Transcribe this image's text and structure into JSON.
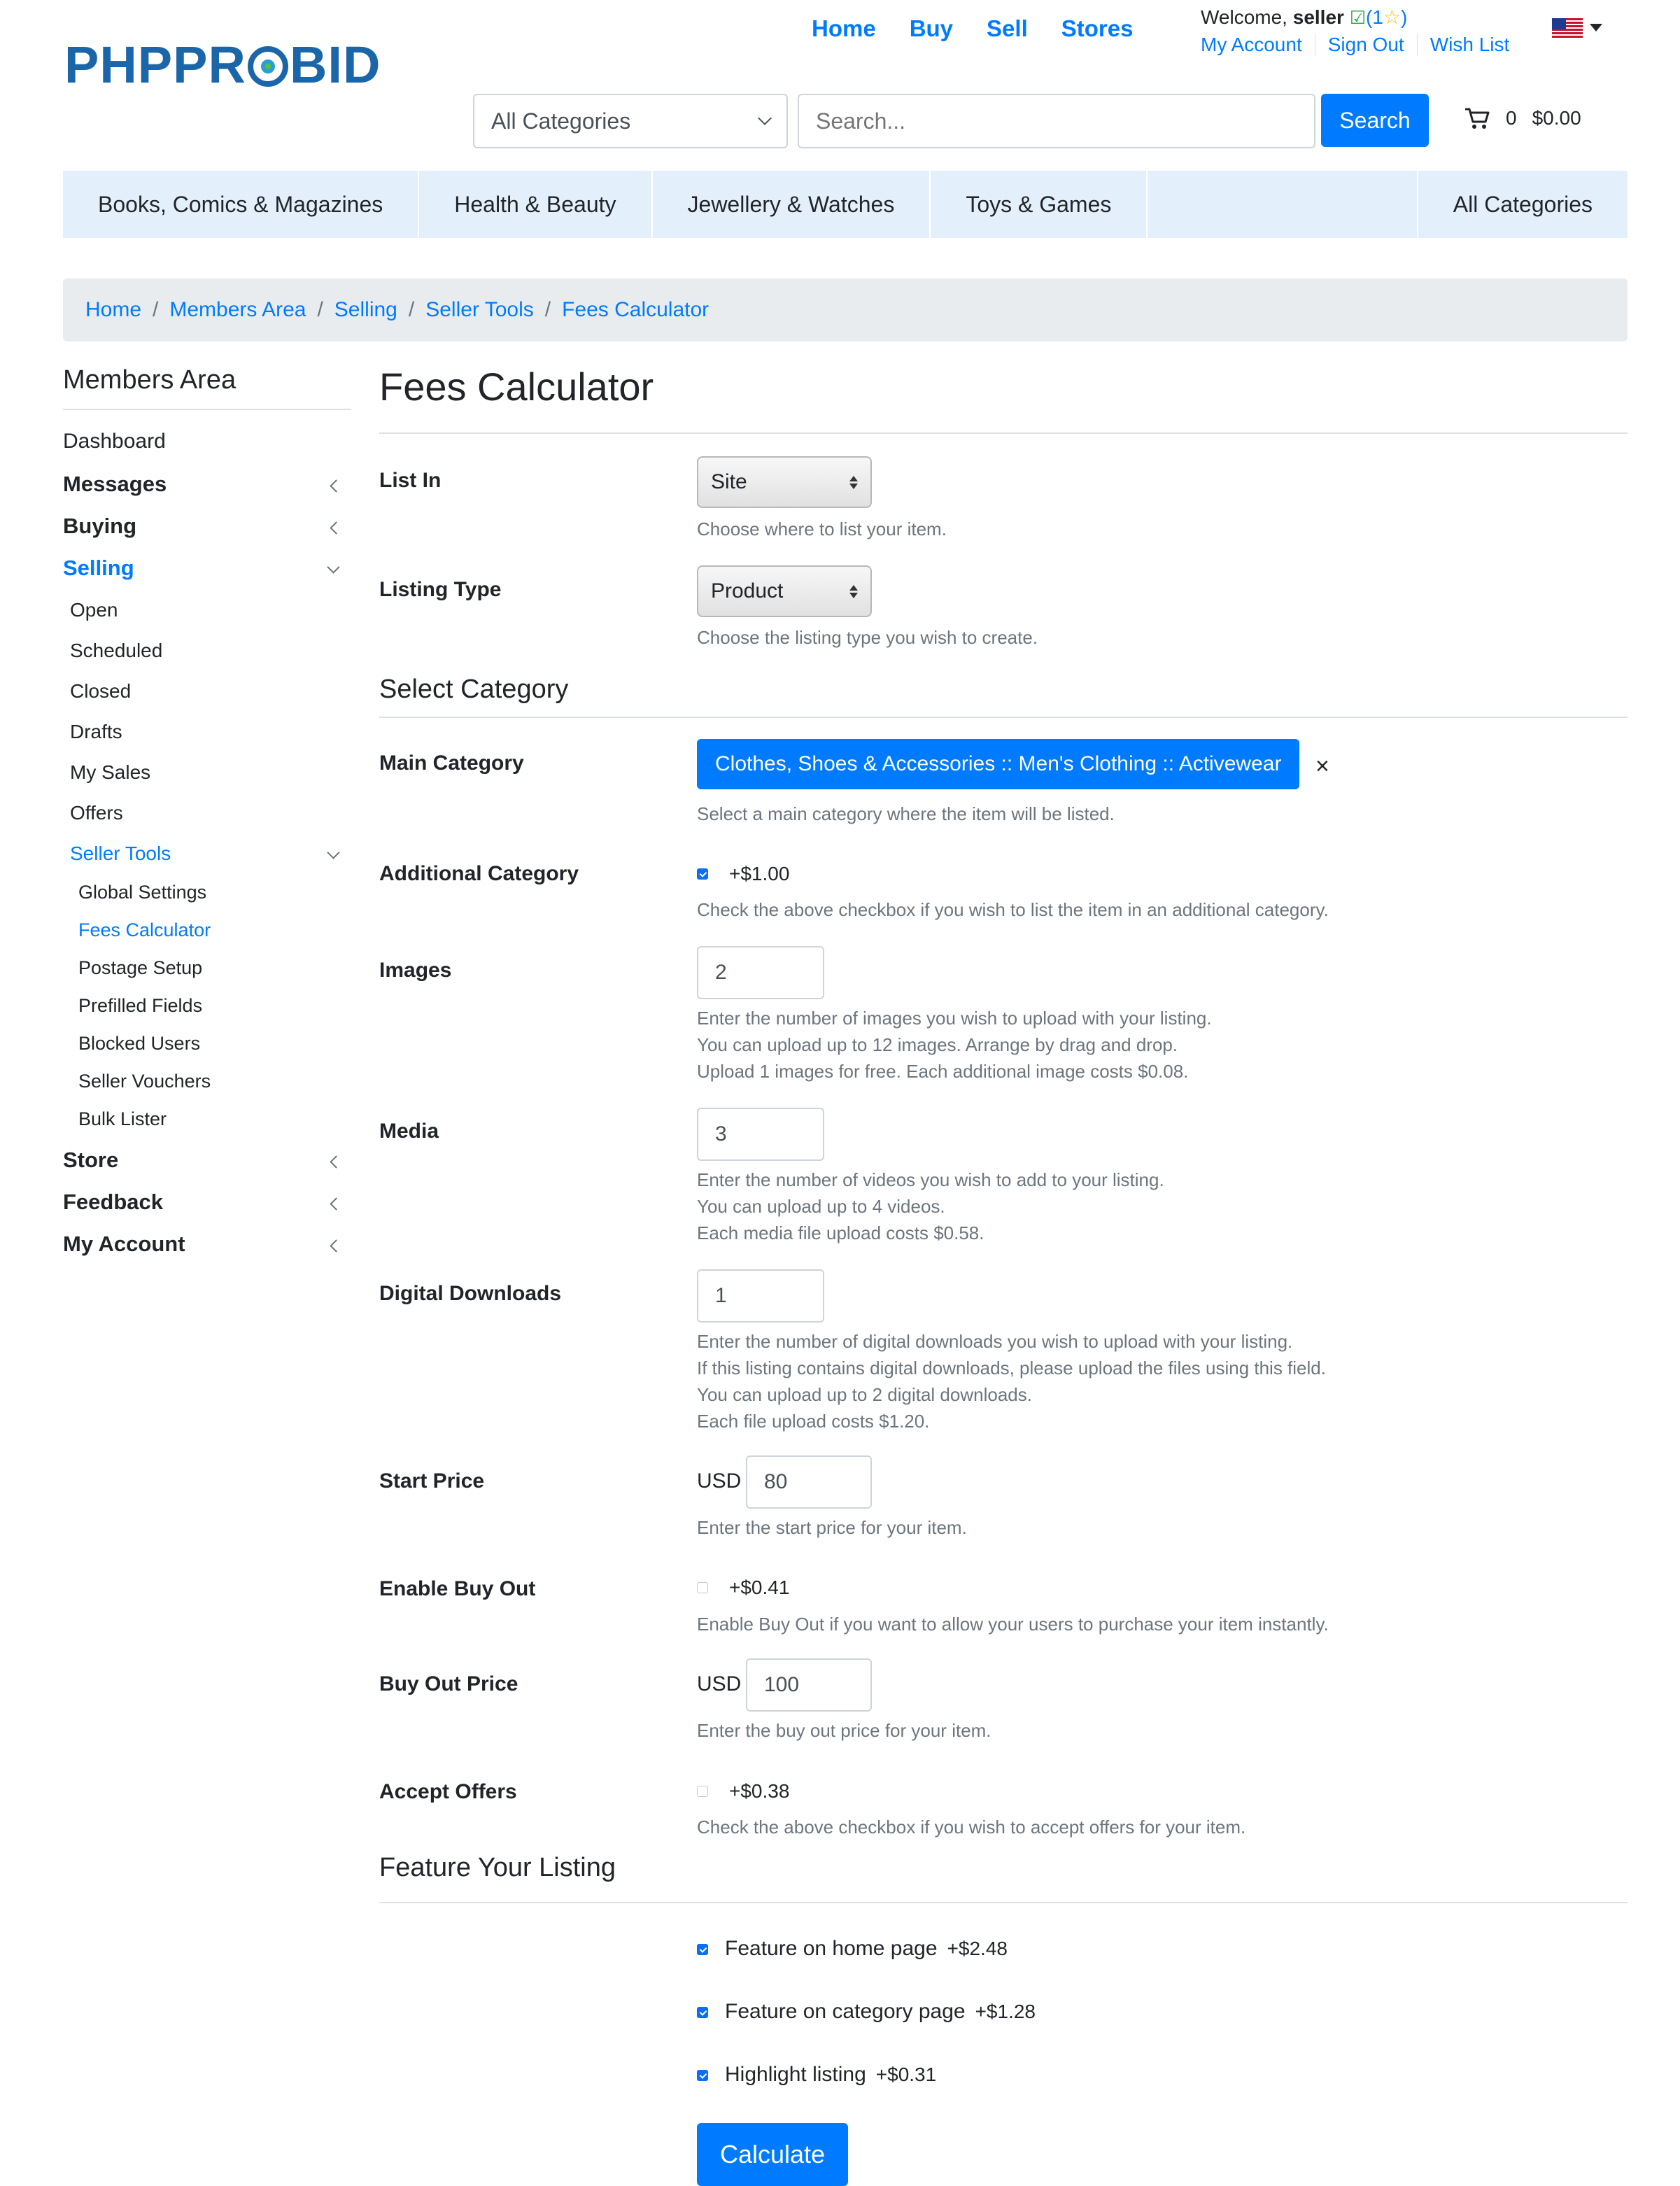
{
  "brand": {
    "logo_left": "PHPPR",
    "logo_right": "BID"
  },
  "topnav": {
    "home": "Home",
    "buy": "Buy",
    "sell": "Sell",
    "stores": "Stores"
  },
  "account": {
    "welcome_prefix": "Welcome,",
    "username": "seller",
    "rating_open": "(1",
    "rating_close": ")",
    "my_account": "My Account",
    "sign_out": "Sign Out",
    "wish_list": "Wish List"
  },
  "search": {
    "category_value": "All Categories",
    "placeholder": "Search...",
    "button_label": "Search"
  },
  "cart": {
    "count": "0",
    "total": "$0.00"
  },
  "categories": [
    "Books, Comics & Magazines",
    "Health & Beauty",
    "Jewellery & Watches",
    "Toys & Games",
    "All Categories"
  ],
  "breadcrumb": [
    "Home",
    "Members Area",
    "Selling",
    "Seller Tools",
    "Fees Calculator"
  ],
  "sidebar": {
    "title": "Members Area",
    "dashboard": "Dashboard",
    "messages": "Messages",
    "buying": "Buying",
    "selling": "Selling",
    "selling_items": [
      "Open",
      "Scheduled",
      "Closed",
      "Drafts",
      "My Sales",
      "Offers"
    ],
    "seller_tools": "Seller Tools",
    "seller_tools_items": [
      "Global Settings",
      "Fees Calculator",
      "Postage Setup",
      "Prefilled Fields",
      "Blocked Users",
      "Seller Vouchers",
      "Bulk Lister"
    ],
    "store": "Store",
    "feedback": "Feedback",
    "my_account": "My Account"
  },
  "main": {
    "title": "Fees Calculator",
    "list_in": {
      "label": "List In",
      "value": "Site",
      "help": "Choose where to list your item."
    },
    "listing_type": {
      "label": "Listing Type",
      "value": "Product",
      "help": "Choose the listing type you wish to create."
    },
    "select_category_heading": "Select Category",
    "main_category": {
      "label": "Main Category",
      "value": "Clothes, Shoes & Accessories :: Men's Clothing :: Activewear",
      "remove": "×",
      "help": "Select a main category where the item will be listed."
    },
    "additional_category": {
      "label": "Additional Category",
      "checked": true,
      "fee": "+$1.00",
      "help": "Check the above checkbox if you wish to list the item in an additional category."
    },
    "images": {
      "label": "Images",
      "value": "2",
      "help": [
        "Enter the number of images you wish to upload with your listing.",
        "You can upload up to 12 images. Arrange by drag and drop.",
        "Upload 1 images for free. Each additional image costs $0.08."
      ]
    },
    "media": {
      "label": "Media",
      "value": "3",
      "help": [
        "Enter the number of videos you wish to add to your listing.",
        "You can upload up to 4 videos.",
        "Each media file upload costs $0.58."
      ]
    },
    "digital_downloads": {
      "label": "Digital Downloads",
      "value": "1",
      "help": [
        "Enter the number of digital downloads you wish to upload with your listing.",
        "If this listing contains digital downloads, please upload the files using this field.",
        "You can upload up to 2 digital downloads.",
        "Each file upload costs $1.20."
      ]
    },
    "start_price": {
      "label": "Start Price",
      "currency": "USD",
      "value": "80",
      "help": "Enter the start price for your item."
    },
    "enable_buy_out": {
      "label": "Enable Buy Out",
      "checked": false,
      "fee": "+$0.41",
      "help": "Enable Buy Out if you want to allow your users to purchase your item instantly."
    },
    "buy_out_price": {
      "label": "Buy Out Price",
      "currency": "USD",
      "value": "100",
      "help": "Enter the buy out price for your item."
    },
    "accept_offers": {
      "label": "Accept Offers",
      "checked": false,
      "fee": "+$0.38",
      "help": "Check the above checkbox if you wish to accept offers for your item."
    },
    "feature_heading": "Feature Your Listing",
    "feature_home": {
      "label": "Feature on home page",
      "fee": "+$2.48",
      "checked": true
    },
    "feature_category": {
      "label": "Feature on category page",
      "fee": "+$1.28",
      "checked": true
    },
    "highlight": {
      "label": "Highlight listing",
      "fee": "+$0.31",
      "checked": true
    },
    "calculate_label": "Calculate"
  },
  "colors": {
    "accent": "#007bff",
    "category_bar": "#e3f0fb",
    "breadcrumb_bg": "#e9ecef",
    "logo": "#1b66a8"
  }
}
